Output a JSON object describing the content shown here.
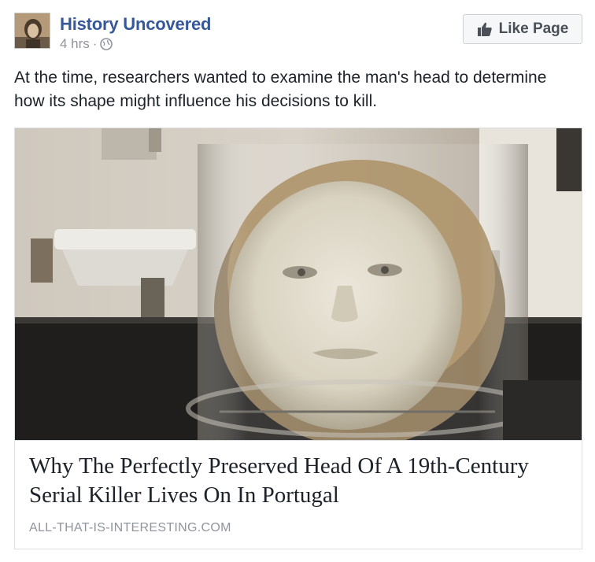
{
  "post": {
    "page_name": "History Uncovered",
    "timestamp": "4 hrs",
    "separator": "·",
    "audience_icon": "globe-icon",
    "like_button_label": "Like Page",
    "like_button_icon": "thumbs-up-icon",
    "text": "At the time, researchers wanted to examine the man's head to determine how its shape might influence his decisions to kill."
  },
  "link": {
    "title": "Why The Perfectly Preserved Head Of A 19th-Century Serial Killer Lives On In Portugal",
    "domain": "ALL-THAT-IS-INTERESTING.COM"
  },
  "colors": {
    "page_name": "#365899",
    "meta_text": "#90949c",
    "body_text": "#1d2129",
    "button_bg": "#f6f7f9",
    "border": "#dddfe2"
  }
}
